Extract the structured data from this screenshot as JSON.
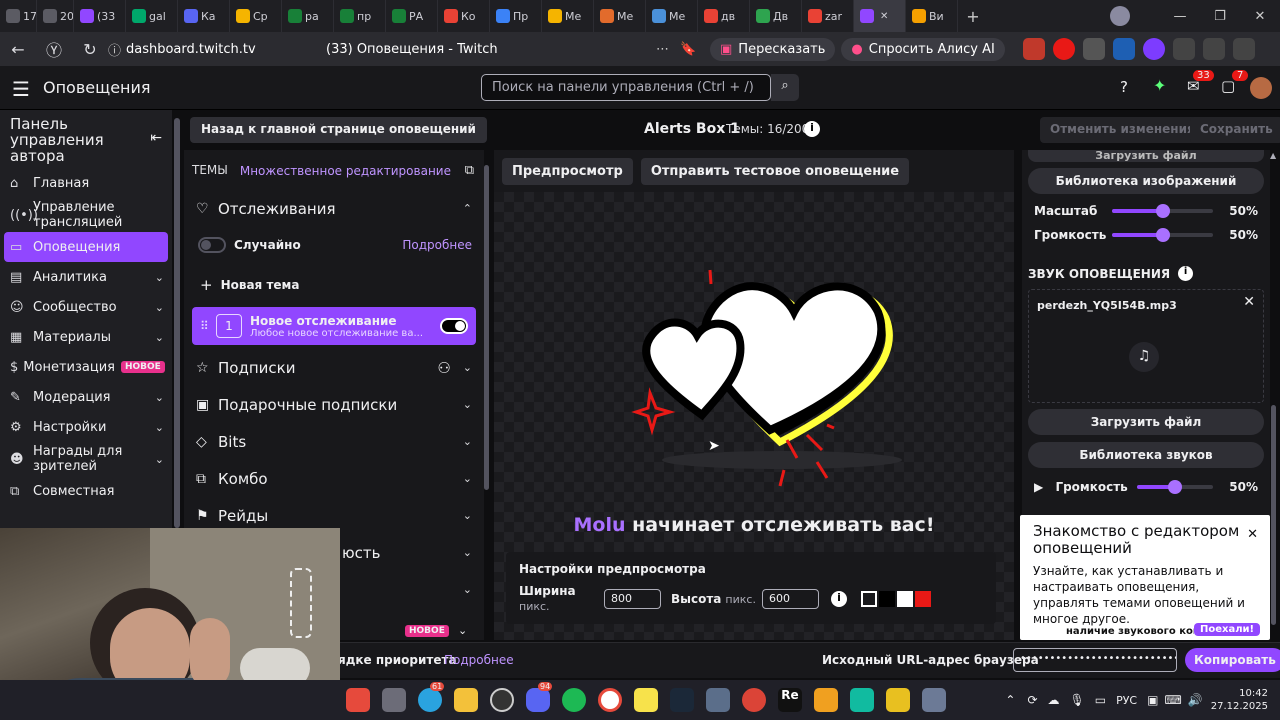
{
  "browser": {
    "tabs": [
      {
        "label": "17",
        "color": "#5b5b63"
      },
      {
        "label": "20 я",
        "color": "#5b5b63"
      },
      {
        "label": "(33",
        "color": "#9147ff"
      },
      {
        "label": "gal",
        "color": "#00a86b"
      },
      {
        "label": "Ка",
        "color": "#5865f2"
      },
      {
        "label": "Ср",
        "color": "#f5b400"
      },
      {
        "label": "ра",
        "color": "#188038"
      },
      {
        "label": "пр",
        "color": "#188038"
      },
      {
        "label": "РА",
        "color": "#188038"
      },
      {
        "label": "Ко",
        "color": "#e94235"
      },
      {
        "label": "Пр",
        "color": "#3b82f6"
      },
      {
        "label": "Ме",
        "color": "#f5b400"
      },
      {
        "label": "Ме",
        "color": "#e26b2c"
      },
      {
        "label": "Ме",
        "color": "#4a90d9"
      },
      {
        "label": "дв",
        "color": "#e94235"
      },
      {
        "label": "Дв",
        "color": "#2ea44f"
      },
      {
        "label": "zar",
        "color": "#e94235"
      },
      {
        "label": "",
        "color": "#9147ff"
      },
      {
        "label": "Ви",
        "color": "#f5a000"
      }
    ],
    "url": "dashboard.twitch.tv",
    "page_title": "(33) Оповещения - Twitch",
    "retell_label": "Пересказать",
    "alice_label": "Спросить Алису AI"
  },
  "header": {
    "menu_title": "Оповещения",
    "search_placeholder": "Поиск на панели управления (Ctrl + /)",
    "inbox_badge": "33",
    "whispers_badge": "7"
  },
  "sidebar": {
    "title": "Панель управления автора",
    "items": [
      {
        "icon": "⌂",
        "label": "Главная",
        "chevron": false
      },
      {
        "icon": "((•))",
        "label": "Управление трансляцией",
        "chevron": false
      },
      {
        "icon": "▭",
        "label": "Оповещения",
        "chevron": false,
        "active": true
      },
      {
        "icon": "▤",
        "label": "Аналитика",
        "chevron": true
      },
      {
        "icon": "☺",
        "label": "Сообщество",
        "chevron": true
      },
      {
        "icon": "▦",
        "label": "Материалы",
        "chevron": true
      },
      {
        "icon": "$",
        "label": "Монетизация",
        "chevron": false,
        "badge": "НОВОЕ"
      },
      {
        "icon": "✎",
        "label": "Модерация",
        "chevron": true
      },
      {
        "icon": "⚙",
        "label": "Настройки",
        "chevron": true
      },
      {
        "icon": "☻",
        "label": "Награды для зрителей",
        "chevron": true
      },
      {
        "icon": "⧉",
        "label": "Совместная",
        "chevron": false
      }
    ]
  },
  "toolbar": {
    "back_label": "Назад к главной странице оповещений",
    "box_title": "Alerts Box 1",
    "themes_count": "Темы: 16/200",
    "cancel_label": "Отменить изменения",
    "save_label": "Сохранить"
  },
  "themes_panel": {
    "header_label": "ТЕМЫ",
    "multi_edit_label": "Множественное редактирование",
    "follows_label": "Отслеживания",
    "random_label": "Случайно",
    "more_label": "Подробнее",
    "new_theme_label": "Новая тема",
    "alert_item": {
      "index": "1",
      "title": "Новое отслеживание",
      "subtitle": "Любое новое отслеживание ва..."
    },
    "sections": [
      "Подписки",
      "Подарочные подписки",
      "Bits",
      "Комбо",
      "Рейды"
    ],
    "partial_label": "юсть",
    "new_badge": "НОВОЕ"
  },
  "preview": {
    "preview_tab": "Предпросмотр",
    "test_tab": "Отправить тестовое оповещение",
    "username": "Molu",
    "message": "начинает отслеживать вас!",
    "settings_title": "Настройки предпросмотра",
    "width_label": "Ширина",
    "width_unit": "пикс.",
    "width_value": "800",
    "height_label": "Высота",
    "height_unit": "пикс.",
    "height_value": "600",
    "swatches": [
      "#ffffff",
      "#000000",
      "#ffffff",
      "#e91916"
    ]
  },
  "right_panel": {
    "upload_file_top": "Загрузить файл",
    "image_library": "Библиотека изображений",
    "scale_label": "Масштаб",
    "scale_value": "50%",
    "scale_fraction": 0.5,
    "volume_label": "Громкость",
    "volume_value": "50%",
    "volume_fraction": 0.5,
    "sound_title": "ЗВУК ОПОВЕЩЕНИЯ",
    "sound_file": "perdezh_YQ5I54B.mp3",
    "upload_file": "Загрузить файл",
    "sound_library": "Библиотека звуков",
    "sound_volume_label": "Громкость",
    "sound_volume_value": "50%",
    "sound_volume_fraction": 0.5
  },
  "tour": {
    "title": "Знакомство с редактором оповещений",
    "body": "Узнайте, как устанавливать и настраивать оповещения, управлять темами оповещений и многое другое.",
    "footer_text": "наличие звукового конте",
    "go_label": "Поехали!"
  },
  "bottom_bar": {
    "priority_text": "ядке приоритета",
    "more_label": "Подробнее",
    "url_label": "Исходный URL-адрес браузера",
    "url_masked": "••••••••••••••••••••••••••••••••••••",
    "copy_label": "Копировать"
  },
  "taskbar": {
    "lang": "РУС",
    "time": "10:42",
    "date": "27.12.2025",
    "mail_badge": "61",
    "discord_badge": "94"
  },
  "colors": {
    "accent": "#9147ff",
    "accent_light": "#a970ff",
    "bg": "#0e0e10",
    "panel": "#18181b"
  }
}
